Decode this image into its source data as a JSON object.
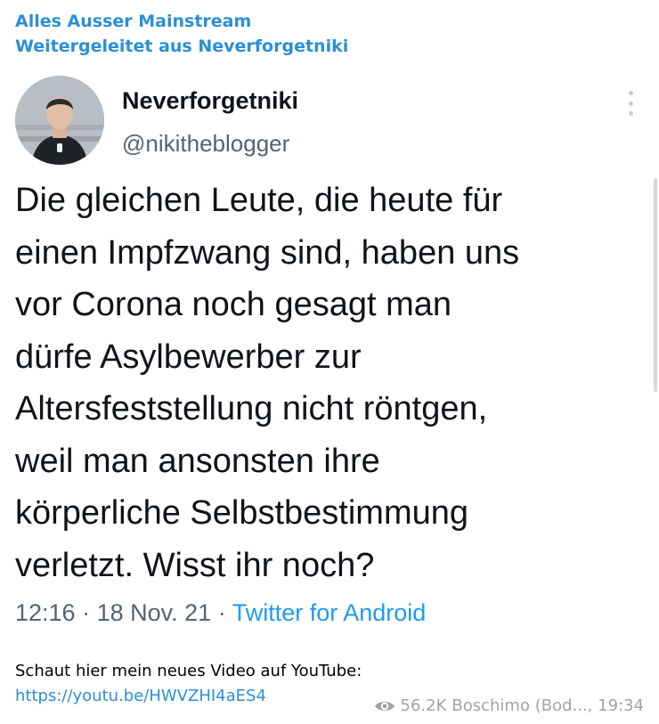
{
  "channel": {
    "name": "Alles Ausser Mainstream",
    "forwarded": "Weitergeleitet aus Neverforgetniki"
  },
  "tweet": {
    "author_name": "Neverforgetniki",
    "author_handle": "@nikitheblogger",
    "text": "Die gleichen Leute, die heute für\neinen Impfzwang sind, haben uns\nvor Corona noch gesagt man\ndürfe Asylbewerber zur\nAltersfeststellung nicht röntgen,\nweil man ansonsten ihre\nkörperliche Selbstbestimmung\nverletzt. Wisst ihr noch?",
    "time": "12:16",
    "date": "18 Nov. 21",
    "source": "Twitter for Android",
    "more_icon": "more-vertical-icon"
  },
  "message": {
    "caption": "Schaut hier mein neues Video auf YouTube:",
    "link": "https://youtu.be/HWVZHI4aES4",
    "views": "56.2K",
    "author_time": "Boschimo (Bod..., 19:34",
    "views_icon": "eye-icon"
  },
  "colors": {
    "channel_blue": "#2b8fd6",
    "twitter_blue": "#1d9bf0",
    "tweet_text": "#0f1419",
    "tweet_gray": "#536471",
    "footer_gray": "#a0a4a8"
  }
}
